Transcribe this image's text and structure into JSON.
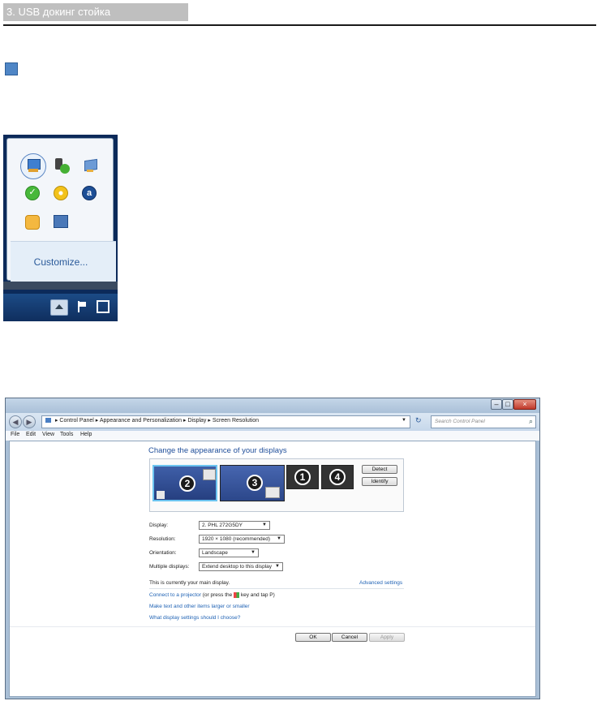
{
  "document": {
    "section_title": "3. USB докинг стойка"
  },
  "tray_popup": {
    "customize_label": "Customize...",
    "icons": [
      "network-icon",
      "usb-check-icon",
      "monitor-network-icon",
      "green-check-icon",
      "cd-disc-icon",
      "blue-a-icon",
      "orange-clock-icon",
      "display-arrow-icon"
    ]
  },
  "window": {
    "controls": {
      "minimize": "–",
      "maximize": "□",
      "close": "×"
    },
    "breadcrumb": [
      "Control Panel",
      "Appearance and Personalization",
      "Display",
      "Screen Resolution"
    ],
    "search_placeholder": "Search Control Panel",
    "menu": [
      "File",
      "Edit",
      "View",
      "Tools",
      "Help"
    ],
    "heading": "Change the appearance of your displays",
    "monitors": [
      "2",
      "3",
      "1",
      "4"
    ],
    "detect_label": "Detect",
    "identify_label": "Identify",
    "form": {
      "display_label": "Display:",
      "display_value": "2. PHL 272G5DY",
      "resolution_label": "Resolution:",
      "resolution_value": "1920 × 1080 (recommended)",
      "orientation_label": "Orientation:",
      "orientation_value": "Landscape",
      "multiple_label": "Multiple displays:",
      "multiple_value": "Extend desktop to this display"
    },
    "main_display_text": "This is currently your main display.",
    "advanced_link": "Advanced settings",
    "projector_link": "Connect to a projector",
    "projector_rest": "(or press the",
    "projector_rest2": "key and tap P)",
    "text_size_link": "Make text and other items larger or smaller",
    "settings_link": "What display settings should I choose?",
    "buttons": {
      "ok": "OK",
      "cancel": "Cancel",
      "apply": "Apply"
    }
  }
}
